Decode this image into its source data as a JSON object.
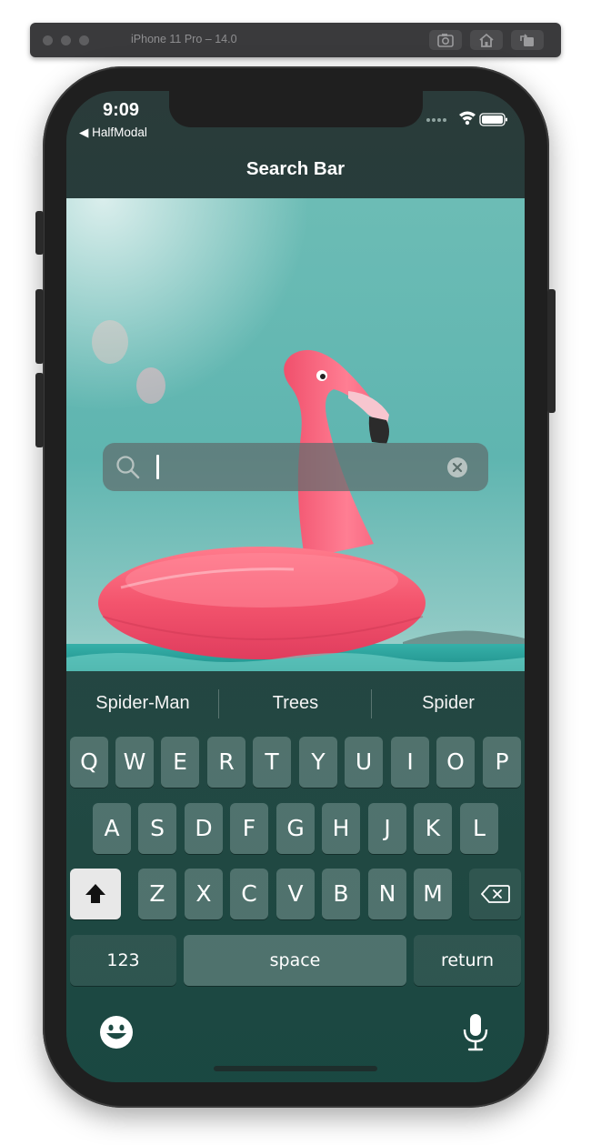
{
  "simulator": {
    "title": "iPhone 11 Pro – 14.0",
    "buttons": [
      "screenshot-icon",
      "home-icon",
      "rotate-icon"
    ]
  },
  "status_bar": {
    "time": "9:09",
    "back_app": "◀ HalfModal",
    "icons": [
      "cellular-dots-icon",
      "wifi-icon",
      "battery-icon"
    ]
  },
  "nav": {
    "title": "Search Bar"
  },
  "search": {
    "value": "",
    "icons": [
      "search-icon",
      "clear-icon"
    ]
  },
  "keyboard": {
    "suggestions": [
      "Spider-Man",
      "Trees",
      "Spider"
    ],
    "row1": [
      "Q",
      "W",
      "E",
      "R",
      "T",
      "Y",
      "U",
      "I",
      "O",
      "P"
    ],
    "row2": [
      "A",
      "S",
      "D",
      "F",
      "G",
      "H",
      "J",
      "K",
      "L"
    ],
    "row3": [
      "Z",
      "X",
      "C",
      "V",
      "B",
      "N",
      "M"
    ],
    "numbers_label": "123",
    "space_label": "space",
    "return_label": "return",
    "icons": [
      "shift-icon",
      "delete-icon",
      "emoji-icon",
      "microphone-icon"
    ]
  },
  "colors": {
    "flamingo": "#f25a73",
    "water": "#5fb5b0",
    "keyboard_tint": "#1d4a43"
  }
}
